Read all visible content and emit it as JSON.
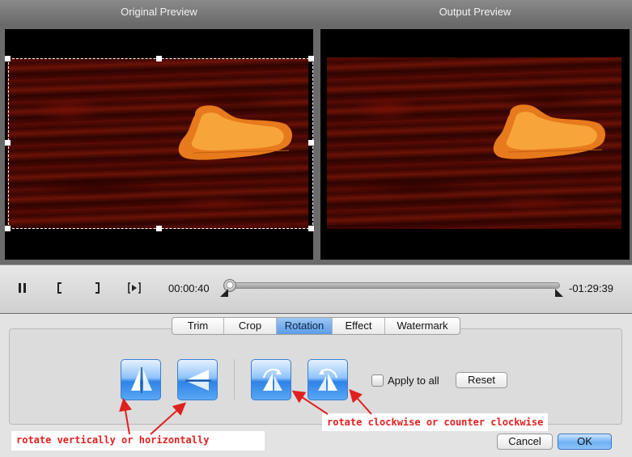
{
  "preview": {
    "original_title": "Original Preview",
    "output_title": "Output Preview"
  },
  "playback": {
    "current_time": "00:00:40",
    "remaining_time": "-01:29:39",
    "progress": 0.01,
    "pause_icon": "pause-icon",
    "mark_in_icon": "bracket-left-icon",
    "mark_out_icon": "bracket-right-icon",
    "next_frame_icon": "next-frame-icon"
  },
  "tabs": [
    {
      "label": "Trim",
      "active": false
    },
    {
      "label": "Crop",
      "active": false
    },
    {
      "label": "Rotation",
      "active": true
    },
    {
      "label": "Effect",
      "active": false
    },
    {
      "label": "Watermark",
      "active": false
    }
  ],
  "rotation": {
    "buttons": [
      {
        "name": "flip-vertical",
        "icon": "flip-vertical-icon"
      },
      {
        "name": "flip-horizontal",
        "icon": "flip-horizontal-icon"
      },
      {
        "name": "rotate-clockwise",
        "icon": "rotate-clockwise-icon"
      },
      {
        "name": "rotate-counter-clockwise",
        "icon": "rotate-counter-clockwise-icon"
      }
    ],
    "apply_to_all_label": "Apply to all",
    "apply_to_all_checked": false,
    "reset_label": "Reset"
  },
  "dialog": {
    "cancel_label": "Cancel",
    "ok_label": "OK"
  },
  "annotations": {
    "flip_note": "rotate vertically or horizontally",
    "rotate_note": "rotate clockwise or counter clockwise"
  },
  "colors": {
    "accent": "#4a95ec",
    "annotation_red": "#e02020"
  }
}
